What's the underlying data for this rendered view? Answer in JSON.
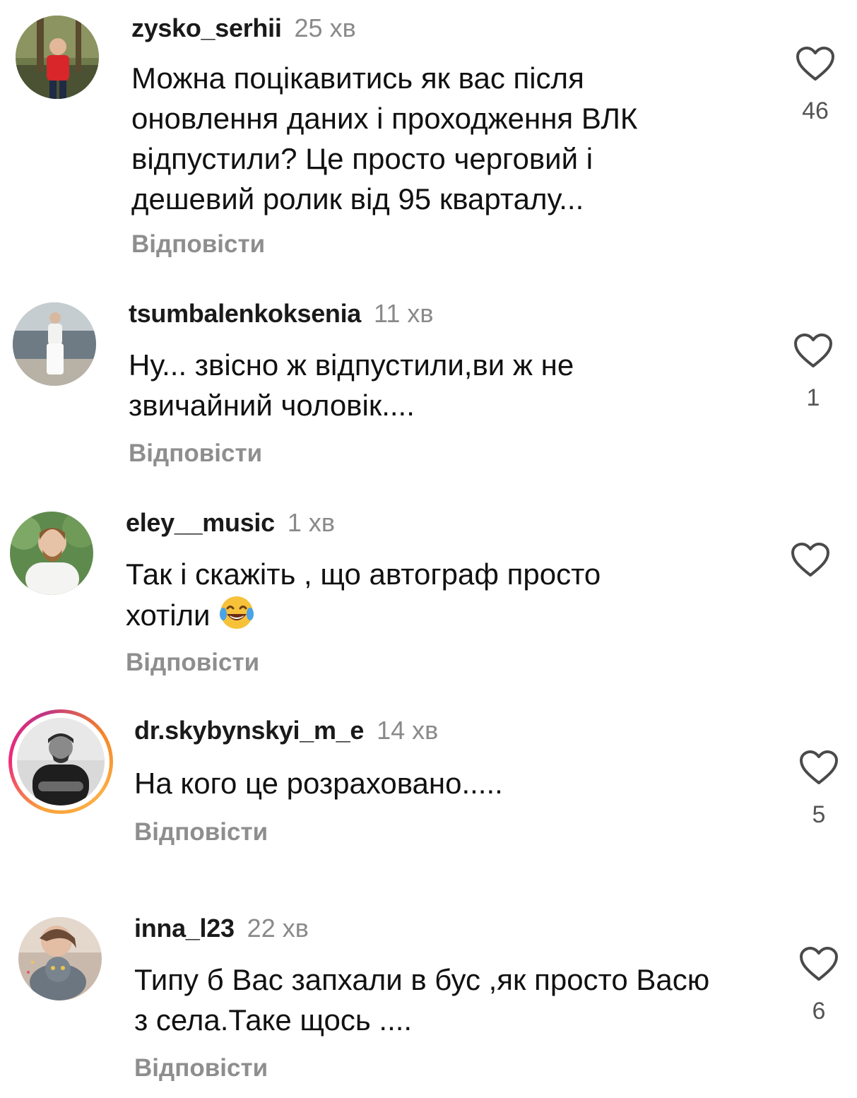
{
  "colors": {
    "text": "#111111",
    "username": "#1a1a1a",
    "time": "#8a8a8a",
    "reply": "#8e8e8e",
    "heart": "#4a4a4a",
    "story_ring_start": "#f9a33a",
    "story_ring_end": "#c13584"
  },
  "comments": [
    {
      "username": "zysko_serhii",
      "time": "25 хв",
      "text": "Можна поцікавитись як вас після оновлення даних і проходження ВЛК відпустили? Це просто черговий і дешевий ролик від 95 кварталу...",
      "reply": "Відповісти",
      "likes": "46",
      "like_icon": "heart-outline-icon",
      "avatar_icon": "avatar-photo"
    },
    {
      "username": "tsumbalenkoksenia",
      "time": "11 хв",
      "text": "Ну... звісно ж відпустили,ви ж не звичайний чоловік....",
      "reply": "Відповісти",
      "likes": "1",
      "like_icon": "heart-outline-icon",
      "avatar_icon": "avatar-photo"
    },
    {
      "username": "eley__music",
      "time": "1 хв",
      "text": "Так і скажіть , що автограф просто хотіли",
      "emoji": "face-with-tears-of-joy",
      "reply": "Відповісти",
      "likes": "",
      "like_icon": "heart-outline-icon",
      "avatar_icon": "avatar-photo"
    },
    {
      "username": "dr.skybynskyi_m_e",
      "time": "14 хв",
      "text": "На кого це розраховано.....",
      "reply": "Відповісти",
      "likes": "5",
      "like_icon": "heart-outline-icon",
      "avatar_icon": "avatar-photo-with-story-ring"
    },
    {
      "username": "inna_l23",
      "time": "22 хв",
      "text": "Типу б Вас запхали в бус ,як просто Васю з села.Таке щось ....",
      "reply": "Відповісти",
      "likes": "6",
      "like_icon": "heart-outline-icon",
      "avatar_icon": "avatar-photo"
    }
  ]
}
